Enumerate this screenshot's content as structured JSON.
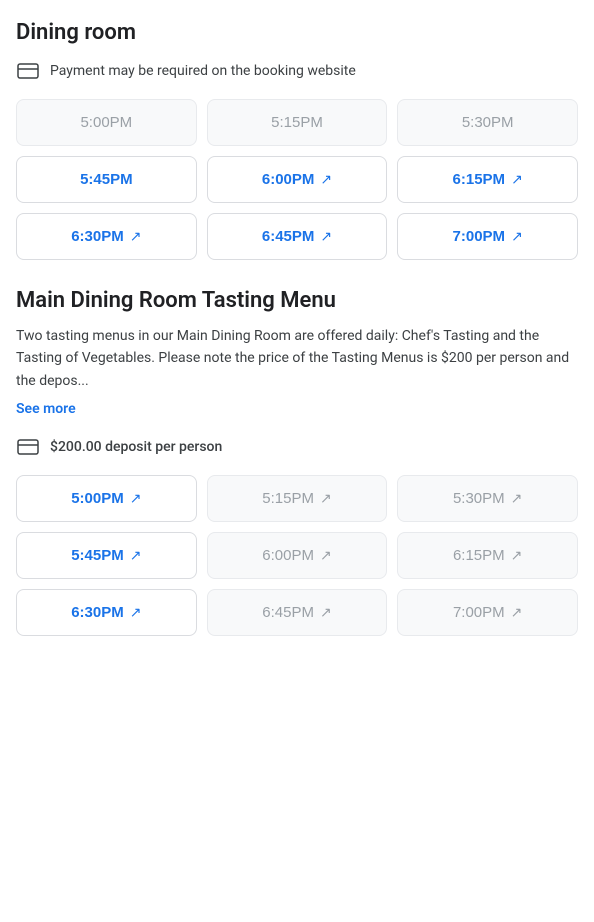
{
  "section1": {
    "title": "Dining room",
    "payment_notice": "Payment may be required on the booking website",
    "time_slots": [
      {
        "time": "5:00PM",
        "state": "unavailable",
        "has_external": false
      },
      {
        "time": "5:15PM",
        "state": "unavailable",
        "has_external": false
      },
      {
        "time": "5:30PM",
        "state": "unavailable",
        "has_external": false
      },
      {
        "time": "5:45PM",
        "state": "available",
        "has_external": false
      },
      {
        "time": "6:00PM",
        "state": "available",
        "has_external": true
      },
      {
        "time": "6:15PM",
        "state": "available",
        "has_external": true
      },
      {
        "time": "6:30PM",
        "state": "available",
        "has_external": true
      },
      {
        "time": "6:45PM",
        "state": "available",
        "has_external": true
      },
      {
        "time": "7:00PM",
        "state": "available",
        "has_external": true
      }
    ]
  },
  "section2": {
    "title": "Main Dining Room Tasting Menu",
    "description": "Two tasting menus in our Main Dining Room are offered daily: Chef's Tasting and the Tasting of Vegetables. Please note the price of the Tasting Menus is $200 per person and the depos...",
    "see_more_label": "See more",
    "deposit_notice": "$200.00 deposit per person",
    "time_slots": [
      {
        "time": "5:00PM",
        "state": "available",
        "has_external": true
      },
      {
        "time": "5:15PM",
        "state": "unavailable",
        "has_external": true
      },
      {
        "time": "5:30PM",
        "state": "unavailable",
        "has_external": true
      },
      {
        "time": "5:45PM",
        "state": "available",
        "has_external": true
      },
      {
        "time": "6:00PM",
        "state": "unavailable",
        "has_external": true
      },
      {
        "time": "6:15PM",
        "state": "unavailable",
        "has_external": true
      },
      {
        "time": "6:30PM",
        "state": "available",
        "has_external": true
      },
      {
        "time": "6:45PM",
        "state": "unavailable",
        "has_external": true
      },
      {
        "time": "7:00PM",
        "state": "unavailable",
        "has_external": true
      }
    ]
  },
  "icons": {
    "card": "card-icon",
    "external": "↗"
  },
  "colors": {
    "available": "#1a73e8",
    "unavailable": "#9aa0a6",
    "accent": "#1a73e8"
  }
}
